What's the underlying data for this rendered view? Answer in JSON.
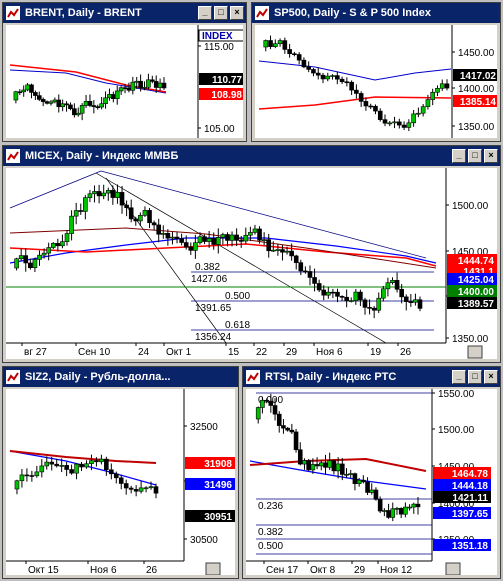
{
  "windows": {
    "brent": {
      "title": "BRENT, Daily - BRENT",
      "axis_badge": "INDEX",
      "y_ticks": [
        "115.00",
        "105.00"
      ],
      "tags": [
        {
          "text": "110.77",
          "bg": "#000000",
          "fg": "#ffffff"
        },
        {
          "text": "108.98",
          "bg": "#ff0000",
          "fg": "#ffffff"
        }
      ]
    },
    "sp500": {
      "title": "SP500, Daily - S & P 500 Index",
      "y_ticks": [
        "1450.00",
        "1400.00",
        "1350.00"
      ],
      "tags": [
        {
          "text": "1417.02",
          "bg": "#000000",
          "fg": "#ffffff"
        },
        {
          "text": "1385.14",
          "bg": "#ff0000",
          "fg": "#ffffff"
        }
      ]
    },
    "micex": {
      "title": "MICEX, Daily - Индекс ММВБ",
      "y_ticks": [
        "1500.00",
        "1450.00",
        "1400.00",
        "1350.00"
      ],
      "x_labels": [
        "вг 27",
        "Сен 10",
        "24",
        "Окт 1",
        "15",
        "22",
        "29",
        "Ноя 6",
        "19",
        "26"
      ],
      "fib_labels": [
        "0.382",
        "1427.06",
        "0.500",
        "1391.65",
        "0.618",
        "1356.24"
      ],
      "tags": [
        {
          "text": "1444.74",
          "bg": "#ff0000",
          "fg": "#ffffff"
        },
        {
          "text": "1431.1",
          "bg": "#ff0000",
          "fg": "#ffffff"
        },
        {
          "text": "1425.04",
          "bg": "#0000ff",
          "fg": "#ffffff"
        },
        {
          "text": "1400.00",
          "bg": "#008000",
          "fg": "#ffffff"
        },
        {
          "text": "1389.57",
          "bg": "#000000",
          "fg": "#ffffff"
        }
      ]
    },
    "siz2": {
      "title": "SIZ2, Daily - Рубль-долла...",
      "y_ticks": [
        "32500",
        "31500",
        "30500"
      ],
      "x_labels": [
        "Окт 15",
        "Ноя 6",
        "26"
      ],
      "tags": [
        {
          "text": "31908",
          "bg": "#ff0000",
          "fg": "#ffffff"
        },
        {
          "text": "31496",
          "bg": "#0000ff",
          "fg": "#ffffff"
        },
        {
          "text": "30951",
          "bg": "#000000",
          "fg": "#ffffff"
        }
      ]
    },
    "rtsi": {
      "title": "RTSI, Daily - Индекс РТС",
      "y_ticks": [
        "1550.00",
        "1500.00",
        "1450.00",
        "1400.00",
        "1350.00"
      ],
      "x_labels": [
        "Сен 17",
        "Окт 8",
        "29",
        "Ноя 12"
      ],
      "fib_labels": [
        "0.000",
        "0.236",
        "0.382",
        "0.500"
      ],
      "tags": [
        {
          "text": "1464.78",
          "bg": "#ff0000",
          "fg": "#ffffff"
        },
        {
          "text": "1444.18",
          "bg": "#0000ff",
          "fg": "#ffffff"
        },
        {
          "text": "1421.11",
          "bg": "#000000",
          "fg": "#ffffff"
        },
        {
          "text": "1397.65",
          "bg": "#0000ff",
          "fg": "#ffffff"
        },
        {
          "text": "1351.18",
          "bg": "#0000ff",
          "fg": "#ffffff"
        }
      ]
    }
  }
}
